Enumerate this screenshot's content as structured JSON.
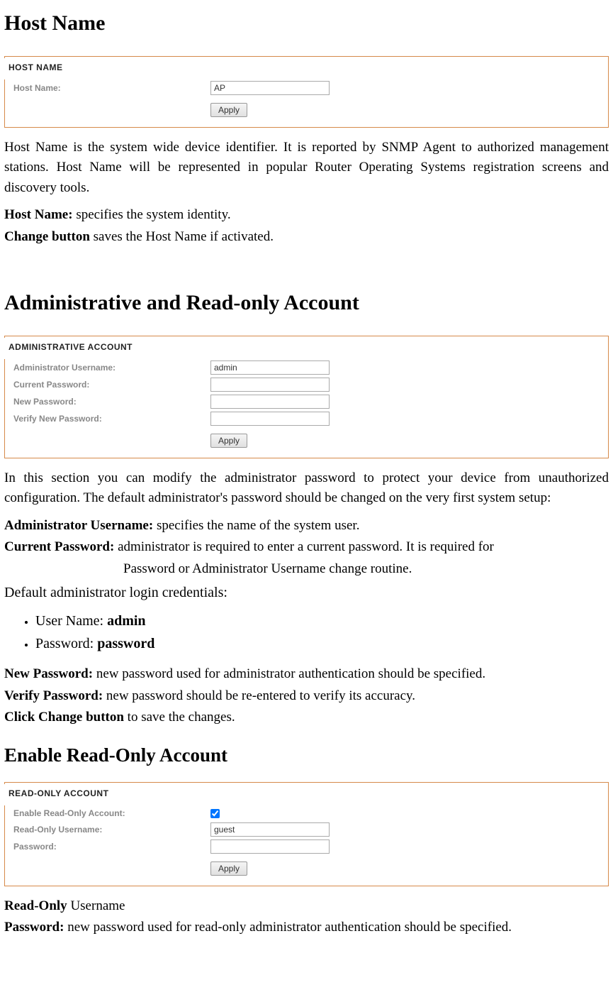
{
  "hostname_section": {
    "title": "Host Name",
    "panel_header": "HOST NAME",
    "field_label": "Host Name:",
    "field_value": "AP",
    "apply_label": "Apply",
    "para1": "Host Name is the system wide device identifier. It is reported by SNMP Agent to authorized management stations. Host Name will be represented in popular Router Operating Systems registration screens and discovery tools.",
    "def1_label": "Host Name:",
    "def1_text": " specifies the system identity.",
    "def2_label": "Change button",
    "def2_text": " saves the Host Name if activated."
  },
  "admin_section": {
    "title": "Administrative and Read-only Account",
    "panel_header": "ADMINISTRATIVE ACCOUNT",
    "fields": {
      "admin_user_label": "Administrator Username:",
      "admin_user_value": "admin",
      "current_pw_label": "Current Password:",
      "current_pw_value": "",
      "new_pw_label": "New Password:",
      "new_pw_value": "",
      "verify_pw_label": "Verify New Password:",
      "verify_pw_value": ""
    },
    "apply_label": "Apply",
    "para1": "In this section you can modify the administrator password to protect your device from unauthorized configuration. The default administrator's password should be changed on the very first system setup:",
    "def_admin_user_label": "Administrator Username:",
    "def_admin_user_text": " specifies the name of the system user.",
    "def_current_pw_label": "Current Password:",
    "def_current_pw_text": " administrator is required to enter a current password. It is required for",
    "def_current_pw_text2": "Password or Administrator Username change routine.",
    "creds_intro": "Default administrator login credentials:",
    "cred_user_label": "User Name: ",
    "cred_user_value": "admin",
    "cred_pw_label": "Password: ",
    "cred_pw_value": "password",
    "def_new_pw_label": "New Password:",
    "def_new_pw_text": " new password used for administrator authentication should be specified.",
    "def_verify_pw_label": "Verify Password:",
    "def_verify_pw_text": " new password should be re-entered to verify its accuracy.",
    "def_click_label": "Click Change button",
    "def_click_text": " to save the changes."
  },
  "readonly_section": {
    "title": "Enable Read-Only Account",
    "panel_header": "READ-ONLY ACCOUNT",
    "fields": {
      "enable_label": "Enable Read-Only Account:",
      "enable_checked": true,
      "ro_user_label": "Read-Only Username:",
      "ro_user_value": "guest",
      "ro_pw_label": "Password:",
      "ro_pw_value": ""
    },
    "apply_label": "Apply",
    "def_ro_label": "Read-Only",
    "def_ro_text": " Username",
    "def_pw_label": "Password:",
    "def_pw_text": " new password used for read-only administrator authentication should be specified."
  }
}
